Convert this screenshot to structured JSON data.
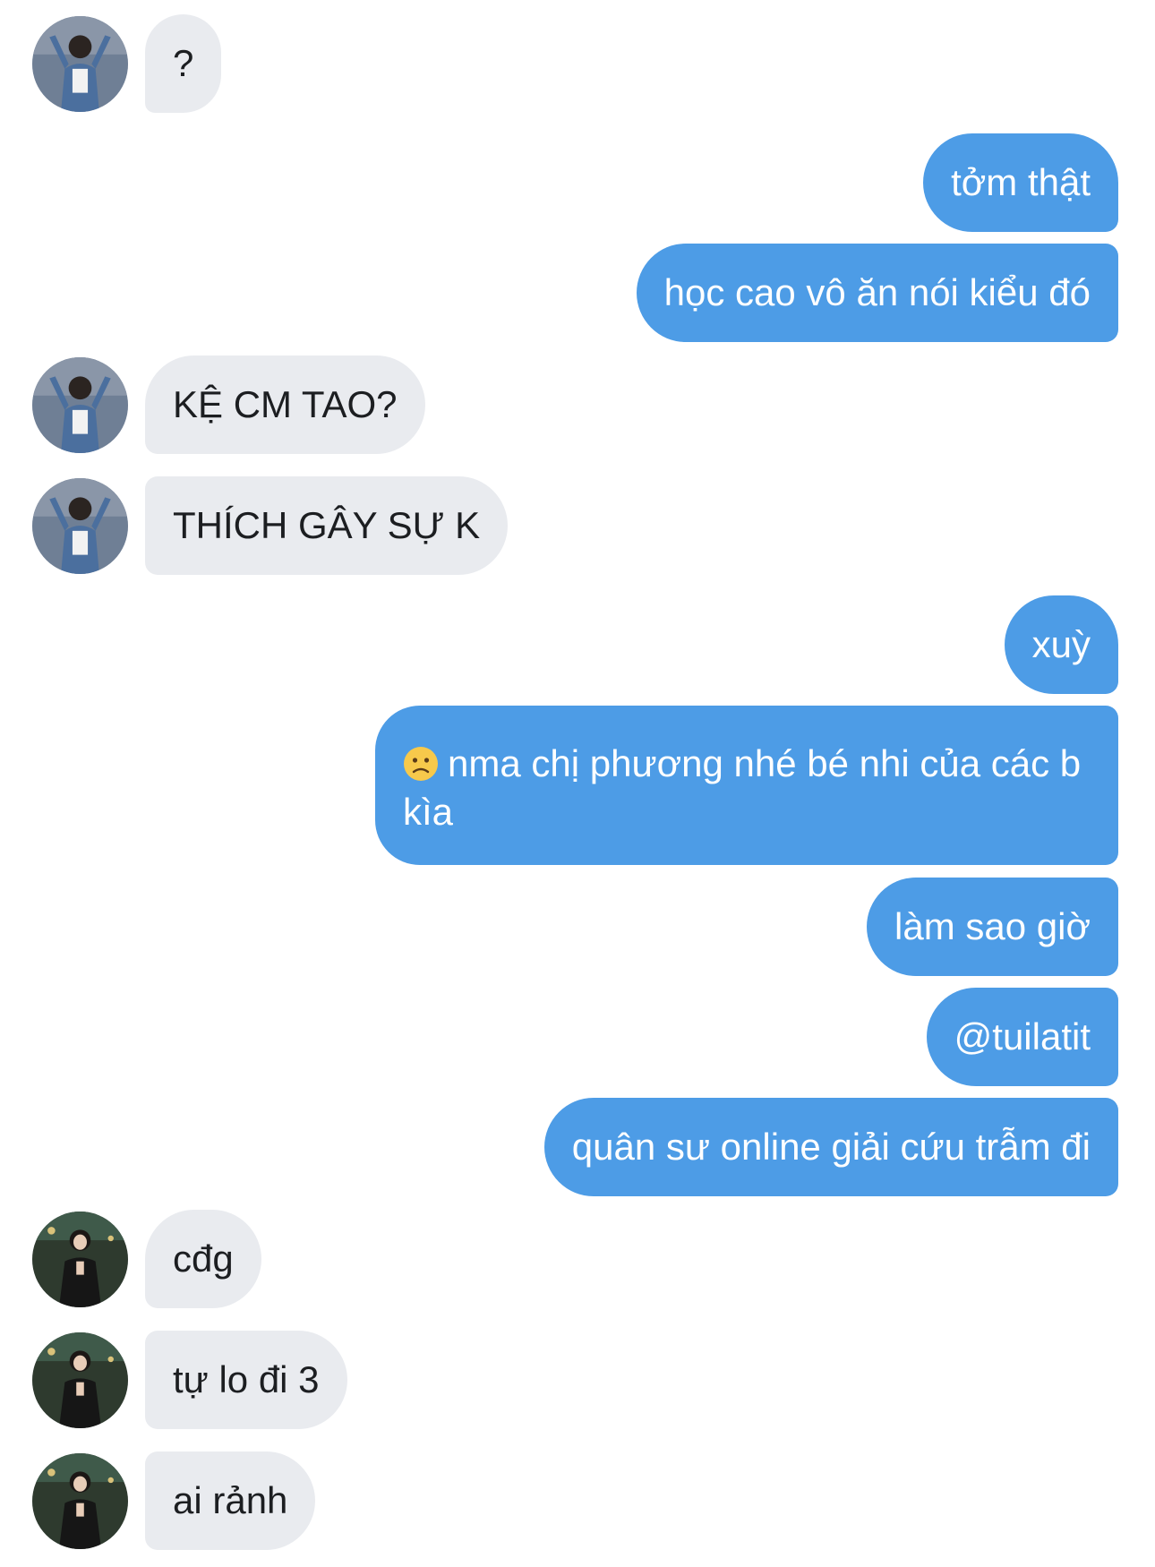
{
  "conversation": {
    "messages": [
      {
        "sender": "other",
        "avatar": "avatar-1",
        "text": "?"
      },
      {
        "sender": "me",
        "text": "tởm thật"
      },
      {
        "sender": "me",
        "text": "học cao vô ăn nói kiểu đó"
      },
      {
        "sender": "other",
        "avatar": "avatar-1",
        "text": "KỆ CM TAO?"
      },
      {
        "sender": "other",
        "avatar": "avatar-1",
        "text": "THÍCH GÂY SỰ K"
      },
      {
        "sender": "me",
        "text": "xuỳ"
      },
      {
        "sender": "me",
        "emoji": "slightly-frowning-face-emoji",
        "text": "nma chị phương nhé bé nhi của các b kìa"
      },
      {
        "sender": "me",
        "text": "làm sao giờ"
      },
      {
        "sender": "me",
        "text": "@tuilatit"
      },
      {
        "sender": "me",
        "text": "quân sư online giải cứu trẫm đi"
      },
      {
        "sender": "other",
        "avatar": "avatar-2",
        "text": "cđg"
      },
      {
        "sender": "other",
        "avatar": "avatar-2",
        "text": "tự lo đi 3"
      },
      {
        "sender": "other",
        "avatar": "avatar-2",
        "text": "ai rảnh"
      }
    ]
  },
  "colors": {
    "outgoing_bubble": "#4d9ce6",
    "incoming_bubble": "#e9ebef",
    "outgoing_text": "#ffffff",
    "incoming_text": "#1c1e21"
  }
}
